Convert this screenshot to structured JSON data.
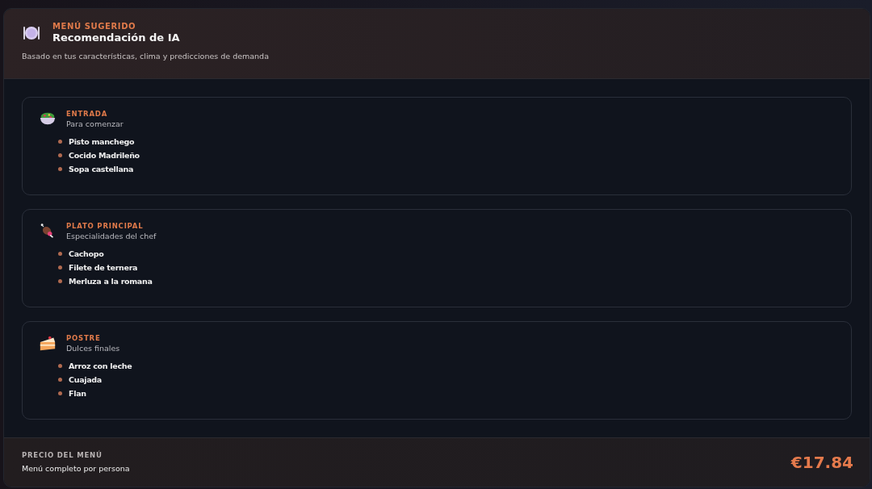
{
  "header": {
    "eyebrow": "MENÚ SUGERIDO",
    "title": "Recomendación de IA",
    "subtitle": "Basado en tus características, clima y predicciones de demanda"
  },
  "courses": [
    {
      "kind": "salad",
      "label": "ENTRADA",
      "subtitle": "Para comenzar",
      "dishes": [
        "Pisto manchego",
        "Cocido Madrileño",
        "Sopa castellana"
      ]
    },
    {
      "kind": "meat",
      "label": "PLATO PRINCIPAL",
      "subtitle": "Especialidades del chef",
      "dishes": [
        "Cachopo",
        "Filete de ternera",
        "Merluza a la romana"
      ]
    },
    {
      "kind": "cake",
      "label": "POSTRE",
      "subtitle": "Dulces finales",
      "dishes": [
        "Arroz con leche",
        "Cuajada",
        "Flan"
      ]
    }
  ],
  "footer": {
    "label": "PRECIO DEL MENÚ",
    "note": "Menú completo por persona",
    "price": "€17.84"
  }
}
